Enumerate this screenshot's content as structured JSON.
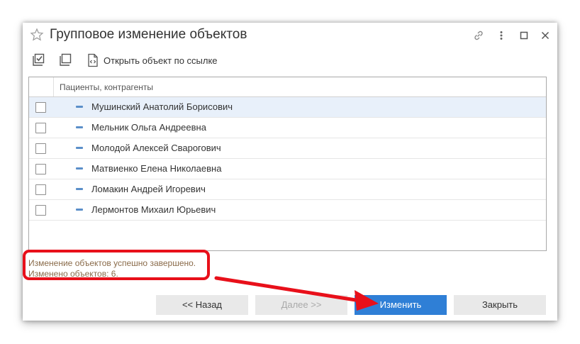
{
  "window": {
    "title": "Групповое изменение объектов"
  },
  "toolbar": {
    "open_link_label": "Открыть объект по ссылке"
  },
  "table": {
    "column_header": "Пациенты, контрагенты",
    "rows": [
      {
        "name": "Мушинский Анатолий Борисович",
        "selected": true,
        "checked": false
      },
      {
        "name": "Мельник Ольга Андреевна",
        "selected": false,
        "checked": false
      },
      {
        "name": "Молодой Алексей Сварогович",
        "selected": false,
        "checked": false
      },
      {
        "name": "Матвиенко Елена Николаевна",
        "selected": false,
        "checked": false
      },
      {
        "name": "Ломакин Андрей Игоревич",
        "selected": false,
        "checked": false
      },
      {
        "name": "Лермонтов Михаил Юрьевич",
        "selected": false,
        "checked": false
      }
    ]
  },
  "status": {
    "line1": "Изменение объектов успешно завершено.",
    "line2": "Изменено объектов: 6."
  },
  "buttons": {
    "back": "<< Назад",
    "next": "Далее >>",
    "change": "Изменить",
    "close": "Закрыть"
  },
  "colors": {
    "accent_button": "#2f7fd6",
    "annotation_red": "#e8101a",
    "status_text": "#8a6b4a"
  }
}
